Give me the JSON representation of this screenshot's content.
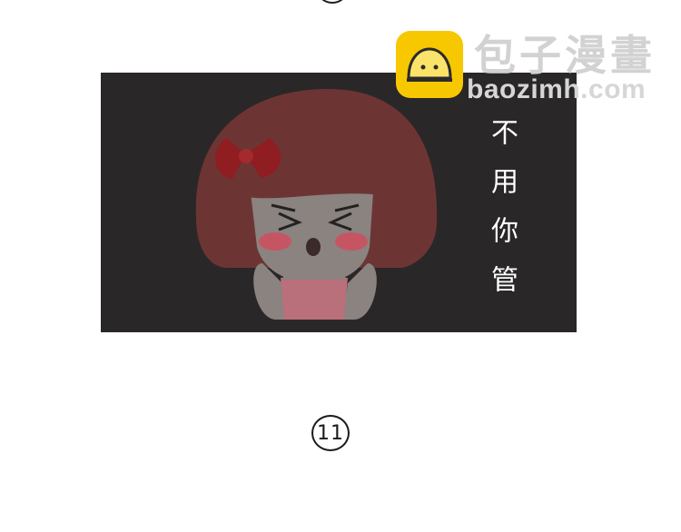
{
  "panel": {
    "caption": "不用你管",
    "background_color": "#2a2728"
  },
  "watermark": {
    "brand": "包子漫畫",
    "domain": "baozimh.com",
    "logo_icon": "bun-face-icon",
    "logo_color": "#f7c800"
  },
  "page": {
    "number": "11"
  }
}
